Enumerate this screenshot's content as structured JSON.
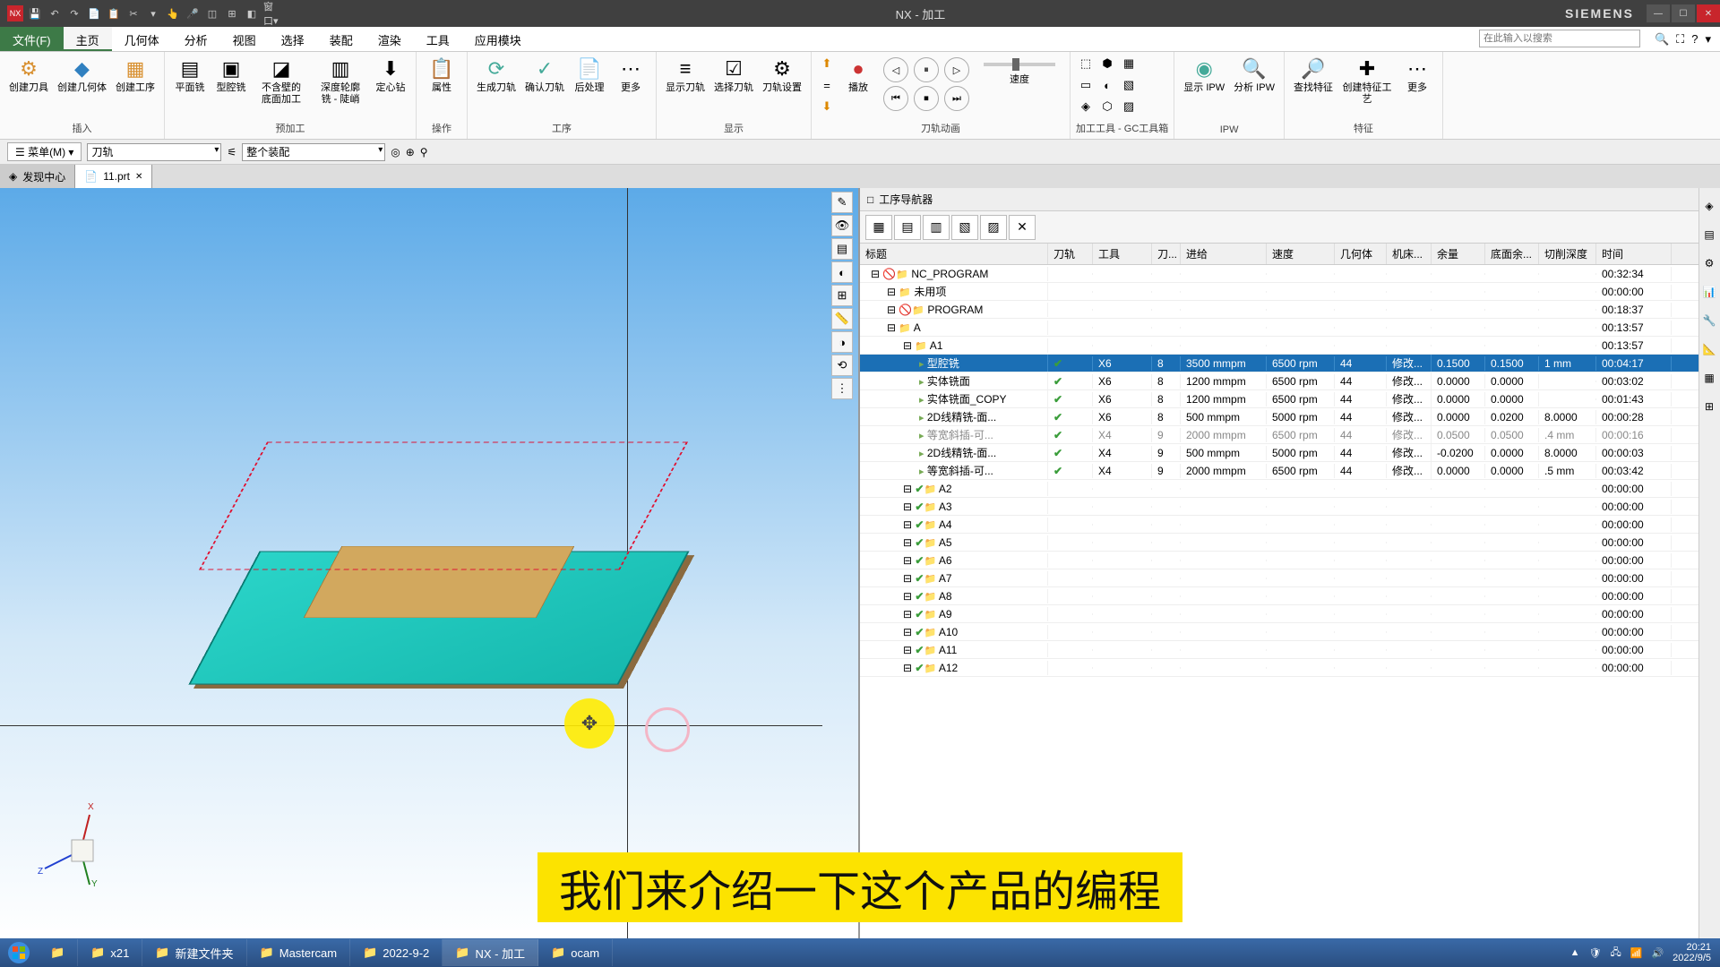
{
  "titlebar": {
    "title": "NX - 加工",
    "brand": "SIEMENS"
  },
  "menus": {
    "file": "文件(F)",
    "home": "主页",
    "geom": "几何体",
    "analysis": "分析",
    "view": "视图",
    "select": "选择",
    "assembly": "装配",
    "render": "渲染",
    "tool": "工具",
    "app": "应用模块",
    "search_ph": "在此输入以搜索"
  },
  "ribbon": {
    "g_insert": "插入",
    "g_prep": "预加工",
    "g_op": "操作",
    "g_toolp": "工序",
    "g_disp": "显示",
    "g_anim": "刀轨动画",
    "g_gc": "加工工具 - GC工具箱",
    "g_ipw": "IPW",
    "g_feat": "特征",
    "create_tool": "创建刀具",
    "create_geom": "创建几何体",
    "create_op": "创建工序",
    "planar": "平面铣",
    "cavity": "型腔铣",
    "wall": "不含壁的\n底面加工",
    "profile": "深度轮廓\n铣 - 陡峭",
    "drill": "定心钻",
    "props": "属性",
    "gen": "生成刀轨",
    "verify": "确认刀轨",
    "post": "后处理",
    "more1": "更多",
    "show_tp": "显示刀轨",
    "sel_tp": "选择刀轨",
    "tp_set": "刀轨设置",
    "play": "播放",
    "speed": "速度",
    "show_ipw": "显示\nIPW",
    "analyze_ipw": "分析\nIPW",
    "find_feat": "查找特征",
    "create_feat": "创建特征工艺",
    "more2": "更多"
  },
  "selbar": {
    "menu": "菜单(M)",
    "dd1": "刀轨",
    "dd2": "整个装配"
  },
  "tabs": {
    "discover": "发现中心",
    "file": "11.prt"
  },
  "navigator": {
    "title": "工序导航器",
    "cols": {
      "title": "标题",
      "track": "刀轨",
      "tool": "工具",
      "toolh": "刀...",
      "feed": "进给",
      "speed": "速度",
      "geom": "几何体",
      "mach": "机床...",
      "stock": "余量",
      "floor": "底面余...",
      "doc": "切削深度",
      "time": "时间"
    },
    "rows": [
      {
        "indent": 0,
        "icon": "no",
        "name": "NC_PROGRAM",
        "time": "00:32:34"
      },
      {
        "indent": 1,
        "icon": "folder",
        "name": "未用项",
        "time": "00:00:00"
      },
      {
        "indent": 1,
        "icon": "no",
        "name": "PROGRAM",
        "time": "00:18:37"
      },
      {
        "indent": 1,
        "icon": "folder",
        "name": "A",
        "time": "00:13:57"
      },
      {
        "indent": 2,
        "icon": "folder",
        "name": "A1",
        "time": "00:13:57"
      },
      {
        "indent": 3,
        "icon": "op",
        "name": "型腔铣",
        "sel": true,
        "track": "✔",
        "tool": "X6",
        "toolh": "8",
        "feed": "3500 mmpm",
        "speed": "6500 rpm",
        "geom": "44",
        "mach": "修改...",
        "stock": "0.1500",
        "floor": "0.1500",
        "doc": "1 mm",
        "time": "00:04:17"
      },
      {
        "indent": 3,
        "icon": "op",
        "name": "实体铣面",
        "track": "✔",
        "tool": "X6",
        "toolh": "8",
        "feed": "1200 mmpm",
        "speed": "6500 rpm",
        "geom": "44",
        "mach": "修改...",
        "stock": "0.0000",
        "floor": "0.0000",
        "doc": "",
        "time": "00:03:02"
      },
      {
        "indent": 3,
        "icon": "op",
        "name": "实体铣面_COPY",
        "track": "✔",
        "tool": "X6",
        "toolh": "8",
        "feed": "1200 mmpm",
        "speed": "6500 rpm",
        "geom": "44",
        "mach": "修改...",
        "stock": "0.0000",
        "floor": "0.0000",
        "doc": "",
        "time": "00:01:43"
      },
      {
        "indent": 3,
        "icon": "op",
        "name": "2D线精铣-面...",
        "track": "✔",
        "tool": "X6",
        "toolh": "8",
        "feed": "500 mmpm",
        "speed": "5000 rpm",
        "geom": "44",
        "mach": "修改...",
        "stock": "0.0000",
        "floor": "0.0200",
        "doc": "8.0000",
        "time": "00:00:28"
      },
      {
        "indent": 3,
        "icon": "op",
        "name": "等宽斜插-可...",
        "dim": true,
        "track": "✔",
        "tool": "X4",
        "toolh": "9",
        "feed": "2000 mmpm",
        "speed": "6500 rpm",
        "geom": "44",
        "mach": "修改...",
        "stock": "0.0500",
        "floor": "0.0500",
        "doc": ".4 mm",
        "time": "00:00:16"
      },
      {
        "indent": 3,
        "icon": "op",
        "name": "2D线精铣-面...",
        "track": "✔",
        "tool": "X4",
        "toolh": "9",
        "feed": "500 mmpm",
        "speed": "5000 rpm",
        "geom": "44",
        "mach": "修改...",
        "stock": "-0.0200",
        "floor": "0.0000",
        "doc": "8.0000",
        "time": "00:00:03"
      },
      {
        "indent": 3,
        "icon": "op",
        "name": "等宽斜插-可...",
        "track": "✔",
        "tool": "X4",
        "toolh": "9",
        "feed": "2000 mmpm",
        "speed": "6500 rpm",
        "geom": "44",
        "mach": "修改...",
        "stock": "0.0000",
        "floor": "0.0000",
        "doc": ".5 mm",
        "time": "00:03:42"
      },
      {
        "indent": 2,
        "icon": "chk",
        "name": "A2",
        "time": "00:00:00"
      },
      {
        "indent": 2,
        "icon": "chk",
        "name": "A3",
        "time": "00:00:00"
      },
      {
        "indent": 2,
        "icon": "chk",
        "name": "A4",
        "time": "00:00:00"
      },
      {
        "indent": 2,
        "icon": "chk",
        "name": "A5",
        "time": "00:00:00"
      },
      {
        "indent": 2,
        "icon": "chk",
        "name": "A6",
        "time": "00:00:00"
      },
      {
        "indent": 2,
        "icon": "chk",
        "name": "A7",
        "time": "00:00:00"
      },
      {
        "indent": 2,
        "icon": "chk",
        "name": "A8",
        "time": "00:00:00"
      },
      {
        "indent": 2,
        "icon": "chk",
        "name": "A9",
        "time": "00:00:00"
      },
      {
        "indent": 2,
        "icon": "chk",
        "name": "A10",
        "time": "00:00:00"
      },
      {
        "indent": 2,
        "icon": "chk",
        "name": "A11",
        "time": "00:00:00"
      },
      {
        "indent": 2,
        "icon": "chk",
        "name": "A12",
        "time": "00:00:00"
      }
    ]
  },
  "subtitle": "我们来介绍一下这个产品的编程",
  "taskbar": {
    "items": [
      {
        "label": "x21"
      },
      {
        "label": "新建文件夹"
      },
      {
        "label": "Mastercam"
      },
      {
        "label": "2022-9-2"
      },
      {
        "label": "NX - 加工",
        "active": true
      },
      {
        "label": "ocam"
      }
    ],
    "time": "20:21",
    "date": "2022/9/5"
  }
}
